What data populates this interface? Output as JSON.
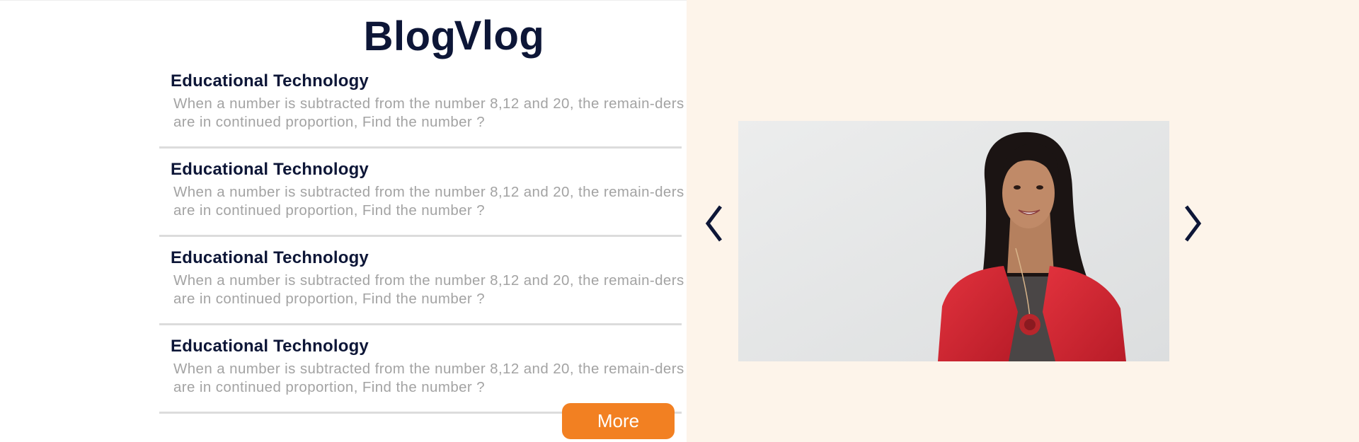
{
  "blog": {
    "title": "Blog",
    "posts": [
      {
        "title": "Educational Technology",
        "excerpt": "When a number is subtracted from the number 8,12 and 20, the remain-ders are in continued proportion, Find the number ?"
      },
      {
        "title": "Educational Technology",
        "excerpt": "When a number is subtracted from the number 8,12 and 20, the remain-ders are in continued proportion, Find the number ?"
      },
      {
        "title": "Educational Technology",
        "excerpt": "When a number is subtracted from the number 8,12 and 20, the remain-ders are in continued proportion, Find the number ?"
      },
      {
        "title": "Educational Technology",
        "excerpt": "When a number is subtracted from the number 8,12 and 20, the remain-ders are in continued proportion, Find the number ?"
      }
    ],
    "more_label": "More"
  },
  "vlog": {
    "title": "Vlog",
    "prev_icon": "chevron-left-icon",
    "next_icon": "chevron-right-icon"
  },
  "colors": {
    "heading": "#0d1637",
    "excerpt_text": "#a3a3a3",
    "divider": "#dcdcdc",
    "accent_button": "#f28022",
    "vlog_background": "#fdf4ea",
    "blog_background": "#ffffff"
  }
}
